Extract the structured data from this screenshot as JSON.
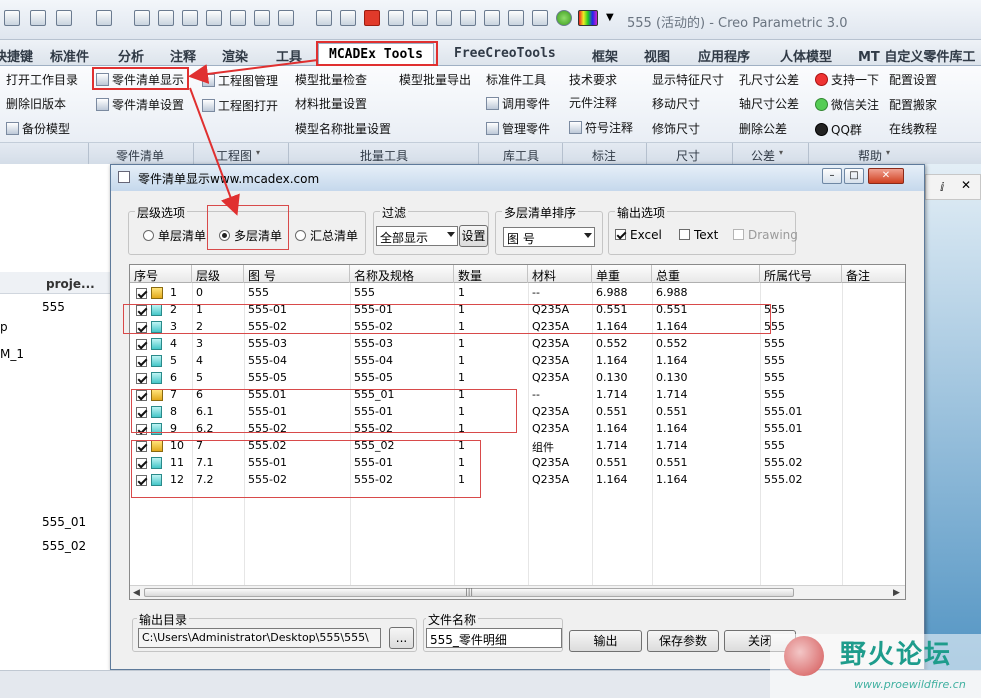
{
  "app": {
    "title": "555 (活动的) - Creo Parametric 3.0"
  },
  "tabs": [
    {
      "label": "快捷键"
    },
    {
      "label": "标准件"
    },
    {
      "label": "分析"
    },
    {
      "label": "注释"
    },
    {
      "label": "渲染"
    },
    {
      "label": "工具"
    },
    {
      "label": "MCADEx Tools"
    },
    {
      "label": "FreeCreoTools"
    },
    {
      "label": "框架"
    },
    {
      "label": "视图"
    },
    {
      "label": "应用程序"
    },
    {
      "label": "人体模型"
    },
    {
      "label": "MT 自定义零件库工"
    }
  ],
  "ribbon": {
    "items": [
      {
        "label": "打开工作目录"
      },
      {
        "label": "删除旧版本"
      },
      {
        "label": "备份模型"
      },
      {
        "label": "零件清单显示"
      },
      {
        "label": "零件清单设置"
      },
      {
        "label": "工程图管理"
      },
      {
        "label": "工程图打开"
      },
      {
        "label": "模型批量检查"
      },
      {
        "label": "模型批量导出"
      },
      {
        "label": "材料批量设置"
      },
      {
        "label": "模型名称批量设置"
      },
      {
        "label": "标准件工具"
      },
      {
        "label": "调用零件"
      },
      {
        "label": "管理零件"
      },
      {
        "label": "技术要求"
      },
      {
        "label": "元件注释"
      },
      {
        "label": "符号注释"
      },
      {
        "label": "显示特征尺寸"
      },
      {
        "label": "移动尺寸"
      },
      {
        "label": "修饰尺寸"
      },
      {
        "label": "孔尺寸公差"
      },
      {
        "label": "轴尺寸公差"
      },
      {
        "label": "删除公差"
      },
      {
        "label": "支持一下"
      },
      {
        "label": "微信关注"
      },
      {
        "label": "QQ群"
      },
      {
        "label": "配置设置"
      },
      {
        "label": "配置搬家"
      },
      {
        "label": "在线教程"
      }
    ],
    "groups": [
      {
        "label": "零件清单"
      },
      {
        "label": "工程图"
      },
      {
        "label": "批量工具"
      },
      {
        "label": "库工具"
      },
      {
        "label": "标注"
      },
      {
        "label": "尺寸"
      },
      {
        "label": "公差"
      },
      {
        "label": "帮助"
      }
    ]
  },
  "left_panel": {
    "header": "proje...",
    "items": [
      "555",
      "555_01",
      "555_02",
      "p",
      "M_1"
    ]
  },
  "dialog": {
    "title": "零件清单显示www.mcadex.com",
    "level_group": {
      "label": "层级选项",
      "options": [
        "单层清单",
        "多层清单",
        "汇总清单"
      ],
      "selected": "多层清单"
    },
    "filter_group": {
      "label": "过滤",
      "value": "全部显示",
      "button": "设置"
    },
    "sort_group": {
      "label": "多层清单排序",
      "value": "图 号"
    },
    "output_group": {
      "label": "输出选项",
      "excel": "Excel",
      "text": "Text",
      "drawing": "Drawing"
    },
    "columns": [
      "序号",
      "层级",
      "图 号",
      "名称及规格",
      "数量",
      "材料",
      "单重",
      "总重",
      "所属代号",
      "备注"
    ],
    "rows": [
      {
        "type": "asm",
        "seq": "1",
        "level": "0",
        "code": "555",
        "name": "555",
        "qty": "1",
        "mat": "--",
        "unit": "6.988",
        "total": "6.988",
        "parent": ""
      },
      {
        "type": "prt",
        "seq": "2",
        "level": "1",
        "code": "555-01",
        "name": "555-01",
        "qty": "1",
        "mat": "Q235A",
        "unit": "0.551",
        "total": "0.551",
        "parent": "555"
      },
      {
        "type": "prt",
        "seq": "3",
        "level": "2",
        "code": "555-02",
        "name": "555-02",
        "qty": "1",
        "mat": "Q235A",
        "unit": "1.164",
        "total": "1.164",
        "parent": "555"
      },
      {
        "type": "prt",
        "seq": "4",
        "level": "3",
        "code": "555-03",
        "name": "555-03",
        "qty": "1",
        "mat": "Q235A",
        "unit": "0.552",
        "total": "0.552",
        "parent": "555"
      },
      {
        "type": "prt",
        "seq": "5",
        "level": "4",
        "code": "555-04",
        "name": "555-04",
        "qty": "1",
        "mat": "Q235A",
        "unit": "1.164",
        "total": "1.164",
        "parent": "555"
      },
      {
        "type": "prt",
        "seq": "6",
        "level": "5",
        "code": "555-05",
        "name": "555-05",
        "qty": "1",
        "mat": "Q235A",
        "unit": "0.130",
        "total": "0.130",
        "parent": "555"
      },
      {
        "type": "asm",
        "seq": "7",
        "level": "6",
        "code": "555.01",
        "name": "555_01",
        "qty": "1",
        "mat": "--",
        "unit": "1.714",
        "total": "1.714",
        "parent": "555"
      },
      {
        "type": "prt",
        "seq": "8",
        "level": "6.1",
        "code": "555-01",
        "name": "555-01",
        "qty": "1",
        "mat": "Q235A",
        "unit": "0.551",
        "total": "0.551",
        "parent": "555.01"
      },
      {
        "type": "prt",
        "seq": "9",
        "level": "6.2",
        "code": "555-02",
        "name": "555-02",
        "qty": "1",
        "mat": "Q235A",
        "unit": "1.164",
        "total": "1.164",
        "parent": "555.01"
      },
      {
        "type": "asm",
        "seq": "10",
        "level": "7",
        "code": "555.02",
        "name": "555_02",
        "qty": "1",
        "mat": "组件",
        "unit": "1.714",
        "total": "1.714",
        "parent": "555"
      },
      {
        "type": "prt",
        "seq": "11",
        "level": "7.1",
        "code": "555-01",
        "name": "555-01",
        "qty": "1",
        "mat": "Q235A",
        "unit": "0.551",
        "total": "0.551",
        "parent": "555.02"
      },
      {
        "type": "prt",
        "seq": "12",
        "level": "7.2",
        "code": "555-02",
        "name": "555-02",
        "qty": "1",
        "mat": "Q235A",
        "unit": "1.164",
        "total": "1.164",
        "parent": "555.02"
      }
    ],
    "output_dir_label": "输出目录",
    "output_dir": "C:\\Users\\Administrator\\Desktop\\555\\555\\",
    "browse_button": "...",
    "filename_label": "文件名称",
    "filename": "555_零件明细",
    "export_button": "输出",
    "save_params_button": "保存参数",
    "close_button": "关闭"
  },
  "watermark": {
    "text": "野火论坛",
    "url": "www.proewildfire.cn"
  },
  "colors": {
    "highlight": "#e03030",
    "accent": "#1e9c8c"
  }
}
